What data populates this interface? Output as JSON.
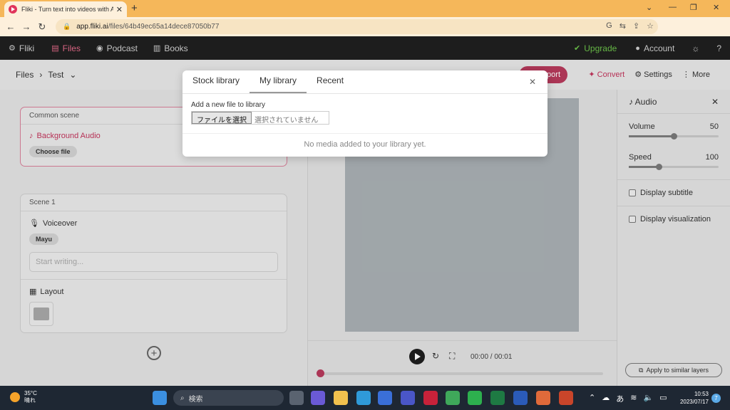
{
  "browser": {
    "tab_title": "Fliki - Turn text into videos with AI",
    "url_host": "app.fliki.ai",
    "url_path": "/files/64b49ec65a14dece87050b77"
  },
  "nav": {
    "brand": "Fliki",
    "files": "Files",
    "podcast": "Podcast",
    "books": "Books",
    "upgrade": "Upgrade",
    "account": "Account"
  },
  "subheader": {
    "crumb_root": "Files",
    "crumb_file": "Test",
    "export": "Export",
    "convert": "Convert",
    "settings": "Settings",
    "more": "More"
  },
  "common_scene": {
    "header": "Common scene",
    "audio_label": "Background Audio",
    "choose_file": "Choose file"
  },
  "scene1": {
    "header": "Scene 1",
    "voiceover_label": "Voiceover",
    "voice_name": "Mayu",
    "placeholder": "Start writing...",
    "layout_label": "Layout"
  },
  "player": {
    "time": "00:00 / 00:01",
    "progress": 0
  },
  "audio_panel": {
    "title": "Audio",
    "volume_label": "Volume",
    "volume_value": "50",
    "volume_fraction": 0.5,
    "speed_label": "Speed",
    "speed_value": "100",
    "speed_fraction": 0.33,
    "display_subtitle": "Display subtitle",
    "display_visualization": "Display visualization",
    "apply_btn": "Apply to similar layers"
  },
  "modal": {
    "tabs": [
      "Stock library",
      "My library",
      "Recent"
    ],
    "add_label": "Add a new file to library",
    "file_button": "ファイルを選択",
    "file_none": "選択されていません",
    "empty_text": "No media added to your library yet."
  },
  "taskbar": {
    "temp": "35°C",
    "weather": "晴れ",
    "search": "検索",
    "time": "10:53",
    "date": "2023/07/17",
    "ime": "あ",
    "notif_count": "7"
  }
}
